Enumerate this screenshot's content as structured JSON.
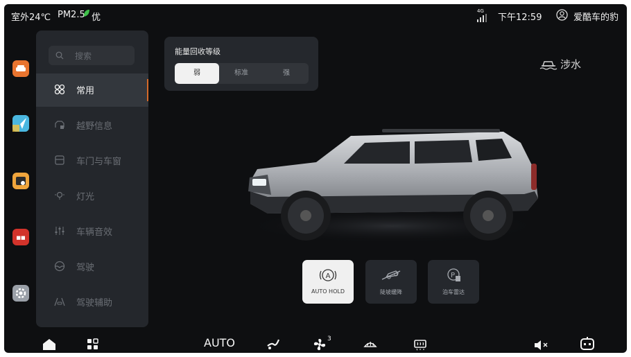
{
  "status": {
    "outside_temp": "室外24℃",
    "pm_label": "PM2.5",
    "pm_quality": "优",
    "signal": "4G",
    "time": "下午12:59",
    "user_name": "爱酷车的豹"
  },
  "dock": {
    "apps": [
      "car-app-icon",
      "navigation-app-icon",
      "media-app-icon",
      "news-app-icon",
      "settings-app-icon"
    ]
  },
  "menu": {
    "search_placeholder": "搜索",
    "items": [
      {
        "label": "常用",
        "icon": "grid-icon",
        "active": true
      },
      {
        "label": "越野信息",
        "icon": "offroad-icon"
      },
      {
        "label": "车门与车窗",
        "icon": "door-icon"
      },
      {
        "label": "灯光",
        "icon": "light-icon"
      },
      {
        "label": "车辆音效",
        "icon": "sound-icon"
      },
      {
        "label": "驾驶",
        "icon": "steering-icon"
      },
      {
        "label": "驾驶辅助",
        "icon": "assist-icon"
      }
    ]
  },
  "energy_recovery": {
    "title": "能量回收等级",
    "options": [
      "弱",
      "标准",
      "强"
    ],
    "selected": "弱"
  },
  "wading": {
    "label": "涉水"
  },
  "controls": [
    {
      "label": "AUTO HOLD",
      "active": true,
      "icon": "auto-hold-icon"
    },
    {
      "label": "陡坡缓降",
      "active": false,
      "icon": "hill-descent-icon"
    },
    {
      "label": "泊车雷达",
      "active": false,
      "icon": "parking-radar-icon"
    }
  ],
  "bottom_bar": {
    "climate_mode": "AUTO",
    "fan_level": "3"
  },
  "colors": {
    "accent": "#d46a2a",
    "leaf": "#3fbf4a",
    "background": "#0e0f11"
  }
}
